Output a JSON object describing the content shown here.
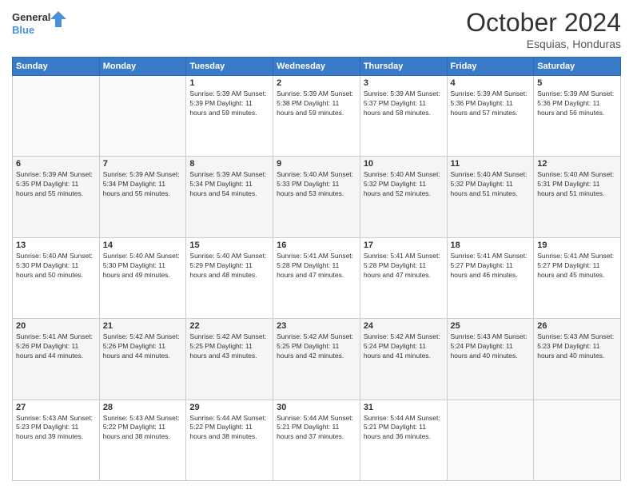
{
  "header": {
    "logo_line1": "General",
    "logo_line2": "Blue",
    "month": "October 2024",
    "location": "Esquias, Honduras"
  },
  "days_of_week": [
    "Sunday",
    "Monday",
    "Tuesday",
    "Wednesday",
    "Thursday",
    "Friday",
    "Saturday"
  ],
  "weeks": [
    [
      {
        "day": "",
        "info": ""
      },
      {
        "day": "",
        "info": ""
      },
      {
        "day": "1",
        "info": "Sunrise: 5:39 AM\nSunset: 5:39 PM\nDaylight: 11 hours and 59 minutes."
      },
      {
        "day": "2",
        "info": "Sunrise: 5:39 AM\nSunset: 5:38 PM\nDaylight: 11 hours and 59 minutes."
      },
      {
        "day": "3",
        "info": "Sunrise: 5:39 AM\nSunset: 5:37 PM\nDaylight: 11 hours and 58 minutes."
      },
      {
        "day": "4",
        "info": "Sunrise: 5:39 AM\nSunset: 5:36 PM\nDaylight: 11 hours and 57 minutes."
      },
      {
        "day": "5",
        "info": "Sunrise: 5:39 AM\nSunset: 5:36 PM\nDaylight: 11 hours and 56 minutes."
      }
    ],
    [
      {
        "day": "6",
        "info": "Sunrise: 5:39 AM\nSunset: 5:35 PM\nDaylight: 11 hours and 55 minutes."
      },
      {
        "day": "7",
        "info": "Sunrise: 5:39 AM\nSunset: 5:34 PM\nDaylight: 11 hours and 55 minutes."
      },
      {
        "day": "8",
        "info": "Sunrise: 5:39 AM\nSunset: 5:34 PM\nDaylight: 11 hours and 54 minutes."
      },
      {
        "day": "9",
        "info": "Sunrise: 5:40 AM\nSunset: 5:33 PM\nDaylight: 11 hours and 53 minutes."
      },
      {
        "day": "10",
        "info": "Sunrise: 5:40 AM\nSunset: 5:32 PM\nDaylight: 11 hours and 52 minutes."
      },
      {
        "day": "11",
        "info": "Sunrise: 5:40 AM\nSunset: 5:32 PM\nDaylight: 11 hours and 51 minutes."
      },
      {
        "day": "12",
        "info": "Sunrise: 5:40 AM\nSunset: 5:31 PM\nDaylight: 11 hours and 51 minutes."
      }
    ],
    [
      {
        "day": "13",
        "info": "Sunrise: 5:40 AM\nSunset: 5:30 PM\nDaylight: 11 hours and 50 minutes."
      },
      {
        "day": "14",
        "info": "Sunrise: 5:40 AM\nSunset: 5:30 PM\nDaylight: 11 hours and 49 minutes."
      },
      {
        "day": "15",
        "info": "Sunrise: 5:40 AM\nSunset: 5:29 PM\nDaylight: 11 hours and 48 minutes."
      },
      {
        "day": "16",
        "info": "Sunrise: 5:41 AM\nSunset: 5:28 PM\nDaylight: 11 hours and 47 minutes."
      },
      {
        "day": "17",
        "info": "Sunrise: 5:41 AM\nSunset: 5:28 PM\nDaylight: 11 hours and 47 minutes."
      },
      {
        "day": "18",
        "info": "Sunrise: 5:41 AM\nSunset: 5:27 PM\nDaylight: 11 hours and 46 minutes."
      },
      {
        "day": "19",
        "info": "Sunrise: 5:41 AM\nSunset: 5:27 PM\nDaylight: 11 hours and 45 minutes."
      }
    ],
    [
      {
        "day": "20",
        "info": "Sunrise: 5:41 AM\nSunset: 5:26 PM\nDaylight: 11 hours and 44 minutes."
      },
      {
        "day": "21",
        "info": "Sunrise: 5:42 AM\nSunset: 5:26 PM\nDaylight: 11 hours and 44 minutes."
      },
      {
        "day": "22",
        "info": "Sunrise: 5:42 AM\nSunset: 5:25 PM\nDaylight: 11 hours and 43 minutes."
      },
      {
        "day": "23",
        "info": "Sunrise: 5:42 AM\nSunset: 5:25 PM\nDaylight: 11 hours and 42 minutes."
      },
      {
        "day": "24",
        "info": "Sunrise: 5:42 AM\nSunset: 5:24 PM\nDaylight: 11 hours and 41 minutes."
      },
      {
        "day": "25",
        "info": "Sunrise: 5:43 AM\nSunset: 5:24 PM\nDaylight: 11 hours and 40 minutes."
      },
      {
        "day": "26",
        "info": "Sunrise: 5:43 AM\nSunset: 5:23 PM\nDaylight: 11 hours and 40 minutes."
      }
    ],
    [
      {
        "day": "27",
        "info": "Sunrise: 5:43 AM\nSunset: 5:23 PM\nDaylight: 11 hours and 39 minutes."
      },
      {
        "day": "28",
        "info": "Sunrise: 5:43 AM\nSunset: 5:22 PM\nDaylight: 11 hours and 38 minutes."
      },
      {
        "day": "29",
        "info": "Sunrise: 5:44 AM\nSunset: 5:22 PM\nDaylight: 11 hours and 38 minutes."
      },
      {
        "day": "30",
        "info": "Sunrise: 5:44 AM\nSunset: 5:21 PM\nDaylight: 11 hours and 37 minutes."
      },
      {
        "day": "31",
        "info": "Sunrise: 5:44 AM\nSunset: 5:21 PM\nDaylight: 11 hours and 36 minutes."
      },
      {
        "day": "",
        "info": ""
      },
      {
        "day": "",
        "info": ""
      }
    ]
  ]
}
